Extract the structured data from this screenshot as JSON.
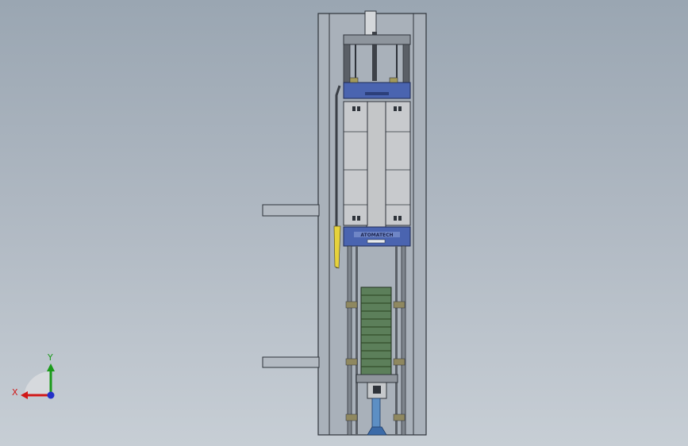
{
  "viewport": {
    "background_top": "#9aa6b2",
    "background_bottom": "#c7ced5"
  },
  "model": {
    "cabinet_color": "#a9b1ba",
    "cabinet_outline": "#2e333a",
    "carriage_color": "#4a64b0",
    "box_color": "#c8cacd",
    "column_color": "#c4c6c8",
    "stack_color": "#5c7f5a",
    "screw_color": "#5d8fc4",
    "accent_yellow": "#e6d23c",
    "label_text": "ATOMATECH"
  },
  "triad": {
    "x_label": "X",
    "y_label": "Y",
    "x_color": "#d01818",
    "y_color": "#1a9a1a",
    "z_color": "#2330c8"
  }
}
